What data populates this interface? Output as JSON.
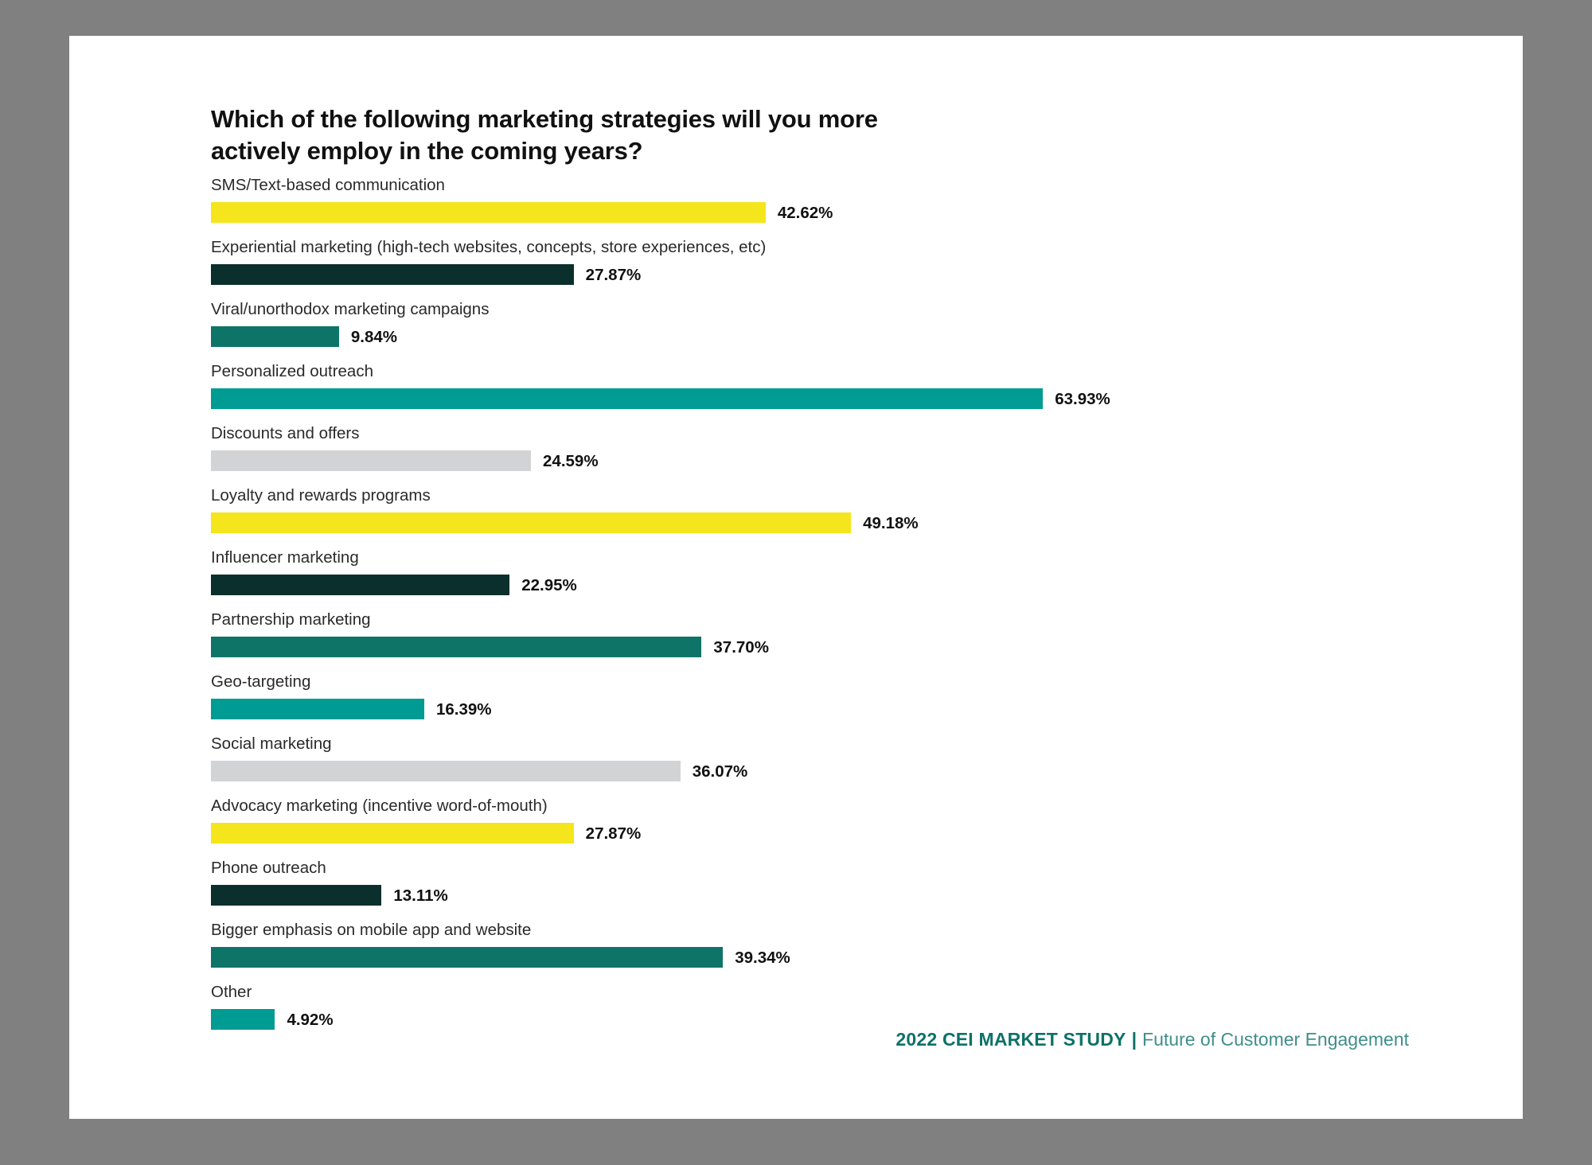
{
  "slide": {
    "background_color": "#808080",
    "card_color": "#ffffff"
  },
  "title": "Which of the following marketing strategies will you more\nactively employ in the coming years?",
  "footer": {
    "brand": "2022 CEI MARKET STUDY",
    "separator": "|",
    "tagline": "Future of Customer Engagement",
    "brand_color": "#0d7168",
    "tagline_color": "#3f8e8b"
  },
  "palette": {
    "yellow": "#f4e51c",
    "dark_teal": "#0b2f2c",
    "mid_teal": "#0e7468",
    "bright_teal": "#009b92",
    "gray": "#d2d3d4"
  },
  "chart_data": {
    "type": "bar",
    "orientation": "horizontal",
    "title": "Which of the following marketing strategies will you more actively employ in the coming years?",
    "xlabel": "",
    "ylabel": "",
    "xlim": [
      0,
      63.93
    ],
    "grid": false,
    "legend": "none",
    "value_suffix": "%",
    "categories": [
      "SMS/Text-based communication",
      "Experiential marketing (high-tech websites, concepts, store experiences, etc)",
      "Viral/unorthodox marketing campaigns",
      "Personalized outreach",
      "Discounts and offers",
      "Loyalty and rewards programs",
      "Influencer marketing",
      "Partnership marketing",
      "Geo-targeting",
      "Social marketing",
      "Advocacy marketing (incentive word-of-mouth)",
      "Phone outreach",
      "Bigger emphasis on mobile app and website",
      "Other"
    ],
    "values": [
      42.62,
      27.87,
      9.84,
      63.93,
      24.59,
      49.18,
      22.95,
      37.7,
      16.39,
      36.07,
      27.87,
      13.11,
      39.34,
      4.92
    ],
    "value_labels": [
      "42.62%",
      "27.87%",
      "9.84%",
      "63.93%",
      "24.59%",
      "49.18%",
      "22.95%",
      "37.70%",
      "16.39%",
      "36.07%",
      "27.87%",
      "13.11%",
      "39.34%",
      "4.92%"
    ],
    "colors": [
      "#f4e51c",
      "#0b2f2c",
      "#0e7468",
      "#009b92",
      "#d2d3d4",
      "#f4e51c",
      "#0b2f2c",
      "#0e7468",
      "#009b92",
      "#d2d3d4",
      "#f4e51c",
      "#0b2f2c",
      "#0e7468",
      "#009b92"
    ]
  }
}
